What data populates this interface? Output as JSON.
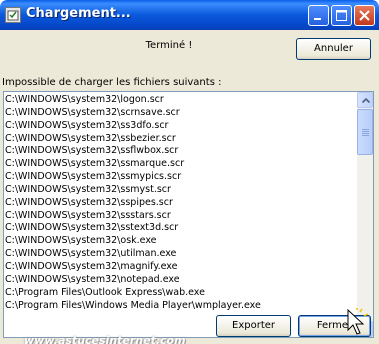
{
  "window": {
    "title": "Chargement..."
  },
  "status_text": "Terminé !",
  "buttons": {
    "cancel_label": "Annuler",
    "export_label": "Exporter",
    "close_label": "Fermer"
  },
  "list_label": "Impossible de charger les fichiers suivants :",
  "files": [
    "C:\\WINDOWS\\system32\\logon.scr",
    "C:\\WINDOWS\\system32\\scrnsave.scr",
    "C:\\WINDOWS\\system32\\ss3dfo.scr",
    "C:\\WINDOWS\\system32\\ssbezier.scr",
    "C:\\WINDOWS\\system32\\ssflwbox.scr",
    "C:\\WINDOWS\\system32\\ssmarque.scr",
    "C:\\WINDOWS\\system32\\ssmypics.scr",
    "C:\\WINDOWS\\system32\\ssmyst.scr",
    "C:\\WINDOWS\\system32\\sspipes.scr",
    "C:\\WINDOWS\\system32\\ssstars.scr",
    "C:\\WINDOWS\\system32\\sstext3d.scr",
    "C:\\WINDOWS\\system32\\osk.exe",
    "C:\\WINDOWS\\system32\\utilman.exe",
    "C:\\WINDOWS\\system32\\magnify.exe",
    "C:\\WINDOWS\\system32\\notepad.exe",
    "C:\\Program Files\\Outlook Express\\wab.exe",
    "C:\\Program Files\\Windows Media Player\\wmplayer.exe"
  ],
  "watermark": "www.astucesinternet.com",
  "colors": {
    "titlebar": "#0a58db",
    "dialog_bg": "#ece9d8",
    "close_button": "#c2391c",
    "list_border": "#7f9db9"
  },
  "icons": [
    "window-app-icon",
    "minimize-icon",
    "maximize-icon",
    "close-icon",
    "scroll-up-icon",
    "scroll-down-icon",
    "pointer-cursor-icon"
  ]
}
